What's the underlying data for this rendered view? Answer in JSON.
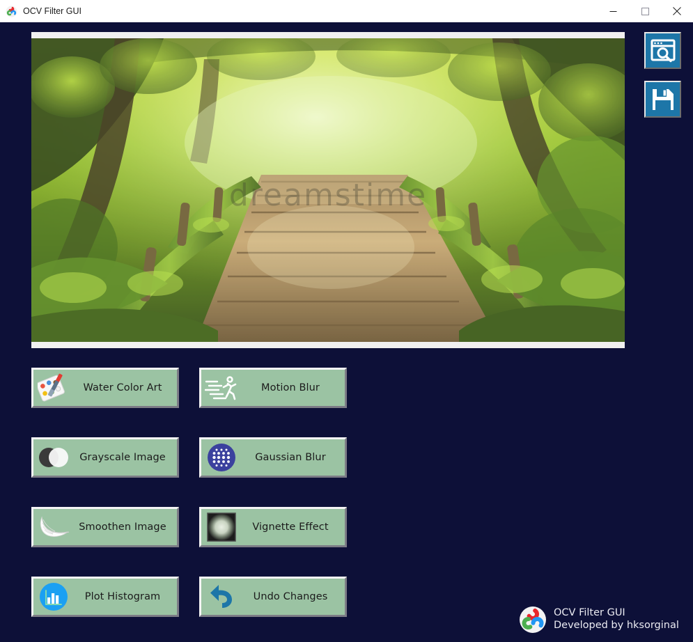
{
  "window": {
    "title": "OCV Filter GUI",
    "app_icon": "opencv-logo-icon",
    "controls": {
      "minimize": "minimize-icon",
      "maximize": "maximize-icon",
      "close": "close-icon"
    }
  },
  "colors": {
    "window_background": "#0d1038",
    "titlebar_background": "#ffffff",
    "button_face": "#9bc3a3",
    "side_button": "#1d76a8",
    "canvas_background": "#f0f0f0",
    "text_dark": "#1b1b1b",
    "text_light": "#ebebf2"
  },
  "canvas": {
    "name": "image-preview",
    "watermark": "dreamstime",
    "description": "Mossy wooden footbridge in a sunlit green forest, watercolor filter applied"
  },
  "side_actions": [
    {
      "id": "open-image",
      "label": "Open Image",
      "icon": "browse-image-icon"
    },
    {
      "id": "save-image",
      "label": "Save Image",
      "icon": "floppy-save-icon"
    }
  ],
  "filters": [
    {
      "id": "water-color",
      "label": "Water Color Art",
      "icon": "paint-palette-icon"
    },
    {
      "id": "motion-blur",
      "label": "Motion Blur",
      "icon": "running-man-icon"
    },
    {
      "id": "grayscale",
      "label": "Grayscale Image",
      "icon": "two-circles-bw-icon"
    },
    {
      "id": "gaussian-blur",
      "label": "Gaussian Blur",
      "icon": "dot-grid-circle-icon"
    },
    {
      "id": "smoothen",
      "label": "Smoothen Image",
      "icon": "feather-icon"
    },
    {
      "id": "vignette",
      "label": "Vignette Effect",
      "icon": "vignette-square-icon"
    },
    {
      "id": "histogram",
      "label": "Plot Histogram",
      "icon": "bar-chart-circle-icon"
    },
    {
      "id": "undo",
      "label": "Undo Changes",
      "icon": "undo-arrow-icon"
    }
  ],
  "branding": {
    "logo": "opencv-logo-icon",
    "line1": "OCV Filter GUI",
    "line2": "Developed by hksorginal"
  }
}
